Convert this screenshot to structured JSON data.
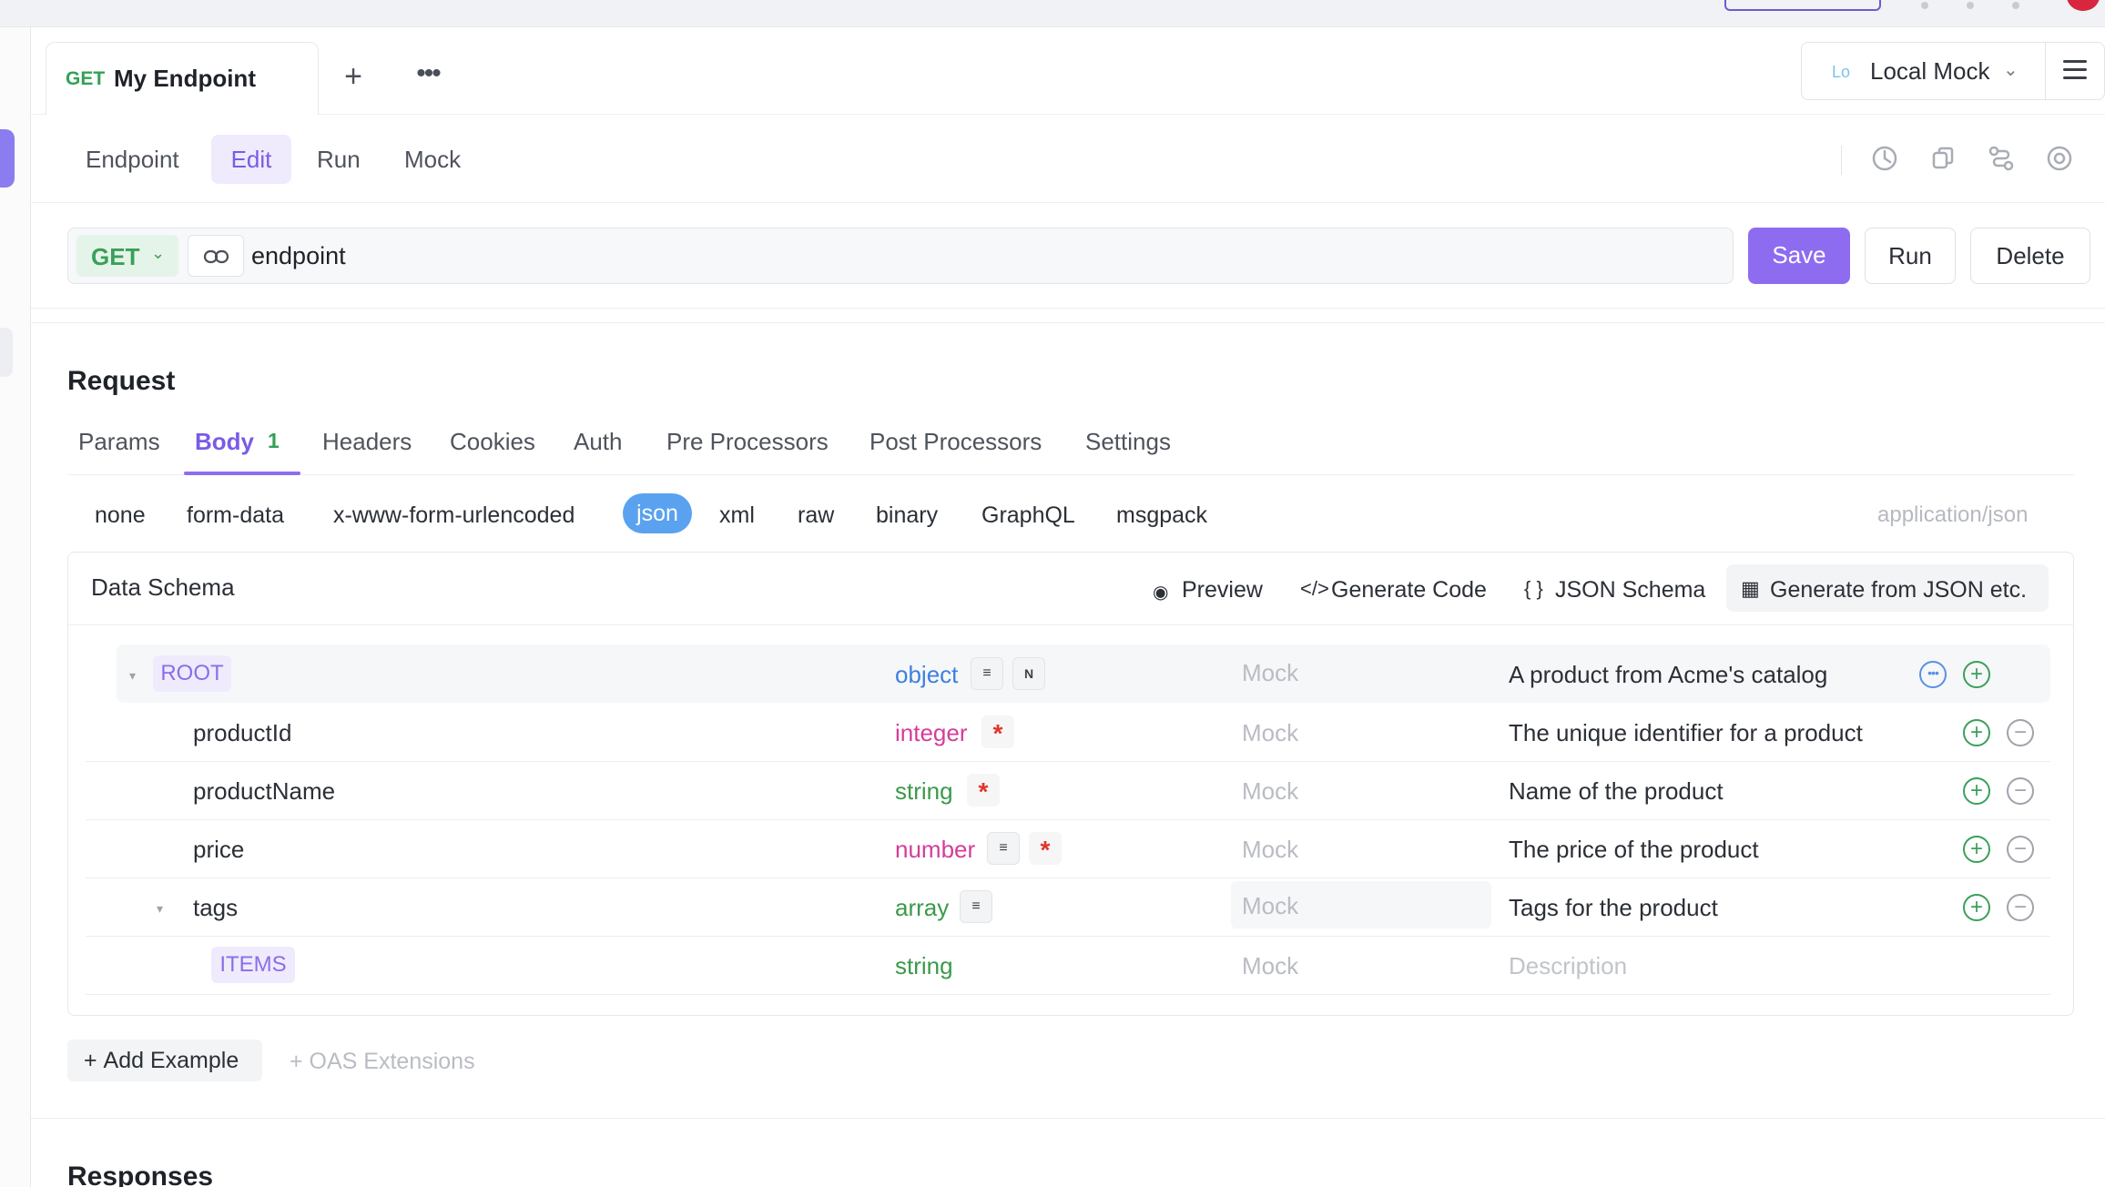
{
  "endpoint_tab": {
    "method": "GET",
    "title": "My Endpoint"
  },
  "environment": {
    "badge": "Lo",
    "label": "Local Mock"
  },
  "subnav": {
    "items": [
      "Endpoint",
      "Edit",
      "Run",
      "Mock"
    ],
    "active": "Edit"
  },
  "url_bar": {
    "method": "GET",
    "path": "endpoint"
  },
  "actions": {
    "save": "Save",
    "run": "Run",
    "delete": "Delete"
  },
  "request": {
    "title": "Request",
    "tabs": [
      "Params",
      "Body",
      "Headers",
      "Cookies",
      "Auth",
      "Pre Processors",
      "Post Processors",
      "Settings"
    ],
    "active_tab": "Body",
    "body_count": "1"
  },
  "body_types": {
    "items": [
      "none",
      "form-data",
      "x-www-form-urlencoded",
      "json",
      "xml",
      "raw",
      "binary",
      "GraphQL",
      "msgpack"
    ],
    "active": "json",
    "content_type": "application/json"
  },
  "schema": {
    "title": "Data Schema",
    "actions": [
      "Preview",
      "Generate Code",
      "JSON Schema",
      "Generate from JSON etc."
    ],
    "rows": [
      {
        "name": "ROOT",
        "type": "object",
        "mock": "Mock",
        "description": "A product from Acme's catalog"
      },
      {
        "name": "productId",
        "type": "integer",
        "mock": "Mock",
        "description": "The unique identifier for a product"
      },
      {
        "name": "productName",
        "type": "string",
        "mock": "Mock",
        "description": "Name of the product"
      },
      {
        "name": "price",
        "type": "number",
        "mock": "Mock",
        "description": "The price of the product"
      },
      {
        "name": "tags",
        "type": "array",
        "mock": "Mock",
        "description": "Tags for the product"
      },
      {
        "name": "ITEMS",
        "type": "string",
        "mock": "Mock",
        "description": "Description"
      }
    ],
    "null_badge": "N",
    "required_mark": "*"
  },
  "footer": {
    "add_example": "Add Example",
    "oas_extensions": "OAS Extensions"
  },
  "responses": {
    "title": "Responses"
  },
  "colors": {
    "accent": "#8e6cf0",
    "get": "#33a056",
    "json_chip": "#5aa2f0"
  }
}
